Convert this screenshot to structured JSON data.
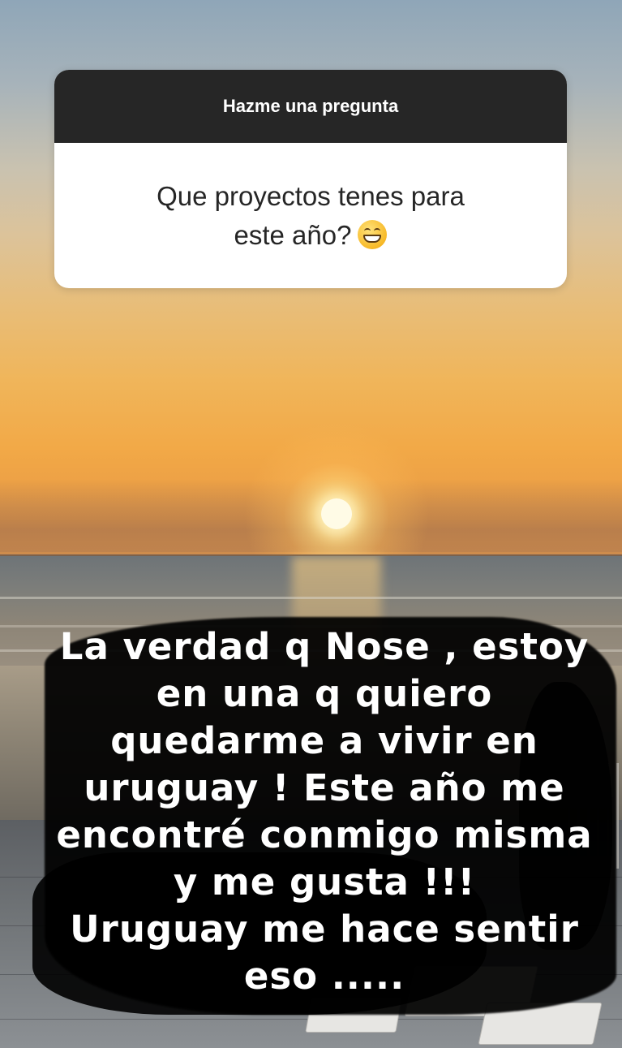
{
  "question_sticker": {
    "header": "Hazme una pregunta",
    "question_lines": [
      "Que proyectos tenes para",
      "este año?"
    ],
    "emoji": "grinning-face-with-smiling-eyes"
  },
  "answer": {
    "lines": [
      "La verdad q Nose , estoy",
      "en una q quiero",
      "quedarme a vivir en",
      "uruguay ! Este año me",
      "encontré conmigo misma",
      "y me gusta  !!!",
      "Uruguay me hace sentir",
      "eso ....."
    ]
  },
  "colors": {
    "header_bg": "#262626",
    "card_bg": "#ffffff",
    "answer_text": "#ffffff",
    "brush": "#000000"
  }
}
